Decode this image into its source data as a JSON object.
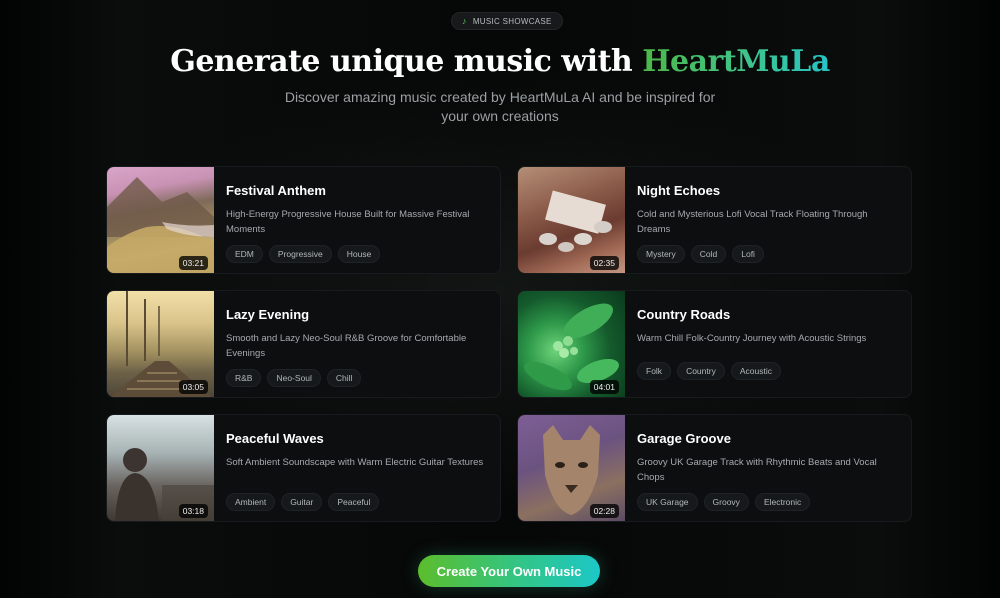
{
  "badge": {
    "icon": "music-note-icon",
    "label": "MUSIC SHOWCASE"
  },
  "hero": {
    "title_prefix": "Generate unique music with ",
    "title_brand": "HeartMuLa",
    "subtitle": "Discover amazing music created by HeartMuLa AI and be inspired for your own creations"
  },
  "tracks": [
    {
      "title": "Festival Anthem",
      "description": "High-Energy Progressive House Built for Massive Festival Moments",
      "duration": "03:21",
      "tags": [
        "EDM",
        "Progressive",
        "House"
      ]
    },
    {
      "title": "Night Echoes",
      "description": "Cold and Mysterious Lofi Vocal Track Floating Through Dreams",
      "duration": "02:35",
      "tags": [
        "Mystery",
        "Cold",
        "Lofi"
      ]
    },
    {
      "title": "Lazy Evening",
      "description": "Smooth and Lazy Neo-Soul R&B Groove for Comfortable Evenings",
      "duration": "03:05",
      "tags": [
        "R&B",
        "Neo-Soul",
        "Chill"
      ]
    },
    {
      "title": "Country Roads",
      "description": "Warm Chill Folk-Country Journey with Acoustic Strings",
      "duration": "04:01",
      "tags": [
        "Folk",
        "Country",
        "Acoustic"
      ]
    },
    {
      "title": "Peaceful Waves",
      "description": "Soft Ambient Soundscape with Warm Electric Guitar Textures",
      "duration": "03:18",
      "tags": [
        "Ambient",
        "Guitar",
        "Peaceful"
      ]
    },
    {
      "title": "Garage Groove",
      "description": "Groovy UK Garage Track with Rhythmic Beats and Vocal Chops",
      "duration": "02:28",
      "tags": [
        "UK Garage",
        "Groovy",
        "Electronic"
      ]
    }
  ],
  "cta": {
    "label": "Create Your Own Music"
  },
  "colors": {
    "accent_green": "#4cb847",
    "accent_teal": "#27c3c6",
    "background": "#050607"
  }
}
